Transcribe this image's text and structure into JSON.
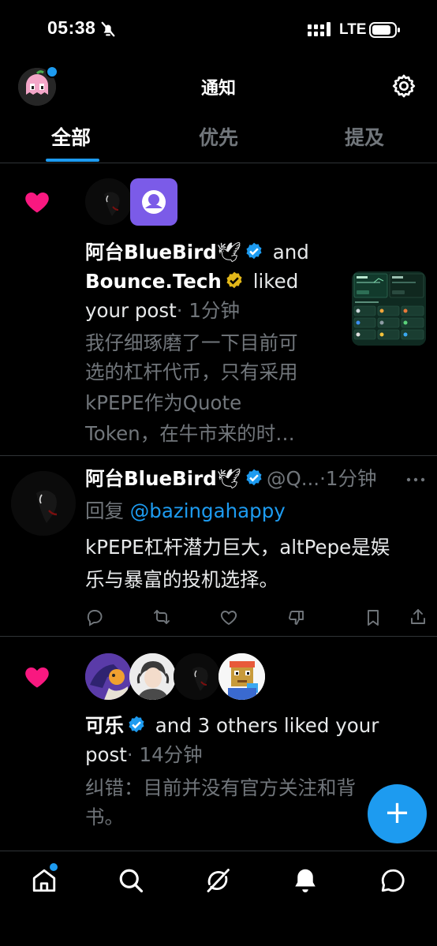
{
  "status_bar": {
    "time": "05:38",
    "network": "LTE",
    "icons": [
      "bell-mute-icon",
      "signal-icon",
      "battery-icon"
    ]
  },
  "header": {
    "title": "通知",
    "settings_icon": "gear-icon"
  },
  "tabs": [
    {
      "label": "全部",
      "active": true
    },
    {
      "label": "优先",
      "active": false
    },
    {
      "label": "提及",
      "active": false
    }
  ],
  "notifications": [
    {
      "type": "like",
      "user1": "阿台BlueBird",
      "user1_emoji": "🕊",
      "and_word": "and",
      "user2": "Bounce.Tech",
      "liked_text": "liked",
      "your_post": "your post",
      "time": "· 1分钟",
      "snippet_lines": [
        "我仔细琢磨了一下目前可",
        "选的杠杆代币，只有采用",
        "kPEPE作为Quote",
        "Token，在牛市来的时…"
      ]
    },
    {
      "type": "reply",
      "user": "阿台BlueBird",
      "user_emoji": "🕊",
      "handle": "@Q...",
      "time": "·1分钟",
      "more_icon": "more-icon",
      "reply_prefix": "回复",
      "reply_handle": "@bazingahappy",
      "text_lines": [
        "kPEPE杠杆潜力巨大，altPepe是娱",
        "乐与暴富的投机选择。"
      ]
    },
    {
      "type": "like",
      "user": "可乐",
      "others_text": "and 3 others liked your",
      "post_word": "post",
      "time": "· 14分钟",
      "snippet_lines": [
        "纠错：目前并没有官方关注和背",
        "书。"
      ]
    }
  ],
  "fab": {
    "label": "+"
  },
  "bottom_nav": [
    "home-icon",
    "search-icon",
    "grok-icon",
    "notifications-icon",
    "messages-icon"
  ],
  "colors": {
    "accent": "#1d9bf0",
    "like": "#f91880",
    "gold_badge": "#e2b719",
    "background": "#000000"
  }
}
